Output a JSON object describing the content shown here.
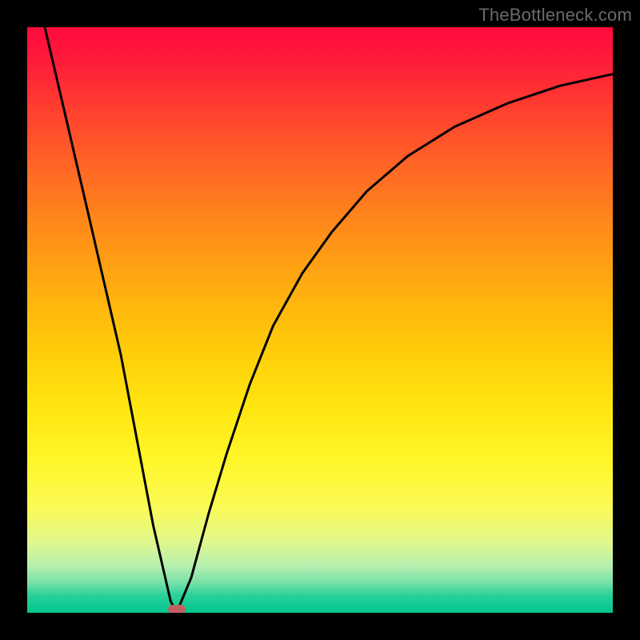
{
  "watermark": "TheBottleneck.com",
  "chart_data": {
    "type": "line",
    "title": "",
    "xlabel": "",
    "ylabel": "",
    "xlim": [
      0,
      1
    ],
    "ylim": [
      0,
      1
    ],
    "series": [
      {
        "name": "curve",
        "x": [
          0.03,
          0.1,
          0.16,
          0.215,
          0.245,
          0.255,
          0.28,
          0.31,
          0.34,
          0.38,
          0.42,
          0.47,
          0.52,
          0.58,
          0.65,
          0.73,
          0.82,
          0.91,
          1.0
        ],
        "y": [
          1.0,
          0.7,
          0.44,
          0.15,
          0.02,
          0.0,
          0.06,
          0.17,
          0.27,
          0.39,
          0.49,
          0.58,
          0.65,
          0.72,
          0.78,
          0.83,
          0.87,
          0.9,
          0.92
        ]
      }
    ],
    "marker": {
      "x": 0.255,
      "y": 0.0
    },
    "background_gradient": {
      "direction": "vertical",
      "stops": [
        "#ff0a3c",
        "#ff9516",
        "#ffe812",
        "#fff629",
        "#00c58e"
      ]
    }
  }
}
